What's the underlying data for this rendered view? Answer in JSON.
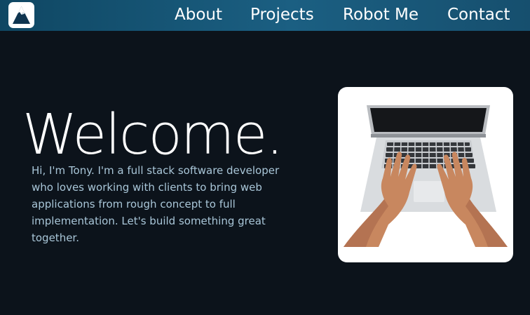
{
  "nav": {
    "logo_icon": "mountain-logo-icon",
    "links": [
      "About",
      "Projects",
      "Robot Me",
      "Contact"
    ]
  },
  "hero": {
    "title": "Welcome.",
    "intro": "Hi, I'm Tony. I'm a full stack software developer who loves working with clients to bring web applications from rough concept to full implementation. Let's build something great together."
  },
  "image": {
    "subject": "laptop-typing-hands-image"
  },
  "colors": {
    "background": "#0c131b",
    "navbar": "#1b5f82",
    "title_text": "#ffffff",
    "body_text": "#a9c6d8"
  }
}
